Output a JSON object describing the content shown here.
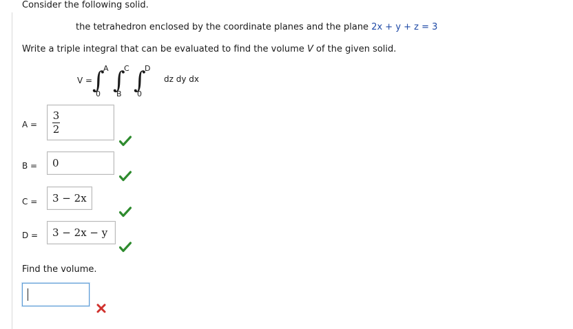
{
  "question": {
    "intro": "Consider the following solid.",
    "solid_prefix": "the tetrahedron enclosed by the coordinate planes and the plane ",
    "plane_equation": "2x + y + z = 3",
    "instruction_prefix": "Write a triple integral that can be evaluated to find the volume ",
    "volume_var": "V",
    "instruction_suffix": " of the given solid."
  },
  "integral": {
    "lhs": "V =",
    "upper_1": "A",
    "lower_1": "0",
    "upper_2": "C",
    "lower_2": "B",
    "upper_3": "D",
    "lower_3": "0",
    "differentials": "dz dy dx"
  },
  "answers": {
    "a": {
      "label": "A =",
      "numerator": "3",
      "denominator": "2",
      "status": "correct"
    },
    "b": {
      "label": "B =",
      "value": "0",
      "status": "correct"
    },
    "c": {
      "label": "C =",
      "value": "3 − 2x",
      "status": "correct"
    },
    "d": {
      "label": "D =",
      "value": "3 − 2x − y",
      "status": "correct"
    }
  },
  "volume": {
    "prompt": "Find the volume.",
    "value": "",
    "status": "incorrect"
  },
  "colors": {
    "check": "#2e8b2e",
    "cross": "#d0312d",
    "equation": "#1f4aa6",
    "focus_border": "#5b9bd5"
  }
}
